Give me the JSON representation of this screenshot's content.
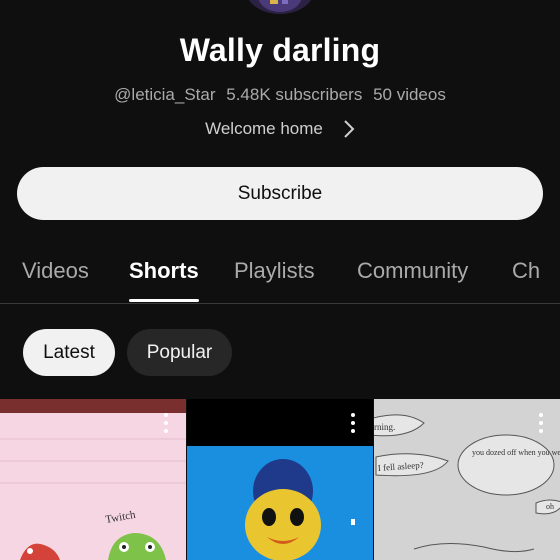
{
  "channel": {
    "name": "Wally darling",
    "handle": "@leticia_Star",
    "subscribers": "5.48K subscribers",
    "videos": "50 videos",
    "description": "Welcome home",
    "subscribe_label": "Subscribe"
  },
  "tabs": [
    {
      "label": "Videos",
      "active": false
    },
    {
      "label": "Shorts",
      "active": true
    },
    {
      "label": "Playlists",
      "active": false
    },
    {
      "label": "Community",
      "active": false
    },
    {
      "label": "Ch",
      "active": false
    }
  ],
  "chips": [
    {
      "label": "Latest",
      "selected": true
    },
    {
      "label": "Popular",
      "selected": false
    }
  ],
  "shorts": [
    {
      "icon": "more-vert-icon",
      "caption": "Twitch"
    },
    {
      "icon": "more-vert-icon"
    },
    {
      "icon": "more-vert-icon",
      "captions": [
        "rning.",
        "I fell asleep?",
        "you dozed off when you were talking about dreams",
        "oh"
      ]
    }
  ],
  "colors": {
    "background": "#0f0f0f",
    "subscribe_bg": "#f1f1f1",
    "chip_bg": "#272727",
    "muted_text": "#aaaaaa"
  }
}
